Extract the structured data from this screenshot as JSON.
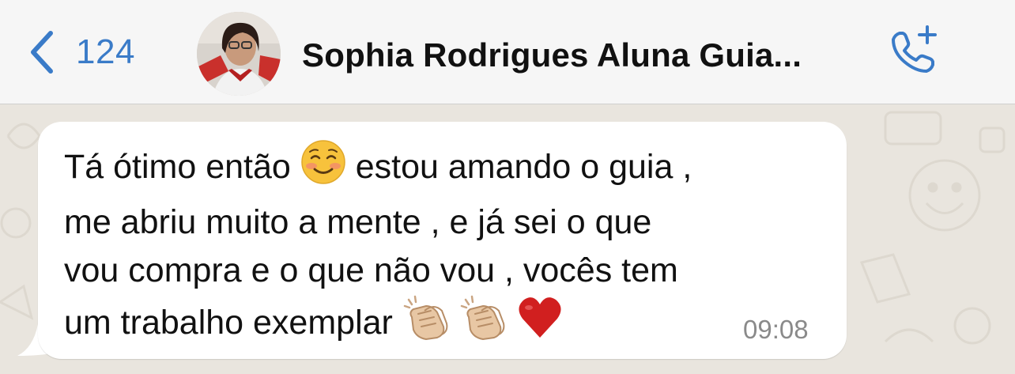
{
  "header": {
    "back_count": "124",
    "contact_name": "Sophia Rodrigues Aluna Guia...",
    "back_icon": "chevron-left-icon",
    "call_icon": "phone-plus-icon"
  },
  "message": {
    "line1_a": "Tá ótimo então",
    "line1_b": "estou amando o guia ,",
    "line2": "me abriu muito a mente , e já sei o que",
    "line3": "vou compra e o que não vou , vocês tem",
    "line4": "um trabalho exemplar",
    "time": "09:08",
    "emojis": [
      "smiling-face-icon",
      "clapping-hands-icon",
      "clapping-hands-icon",
      "red-heart-icon"
    ]
  },
  "colors": {
    "accent": "#3a7bc8",
    "header_bg": "#f6f6f6",
    "chat_bg": "#e9e5de",
    "bubble_bg": "#ffffff",
    "heart": "#d11f1f"
  }
}
